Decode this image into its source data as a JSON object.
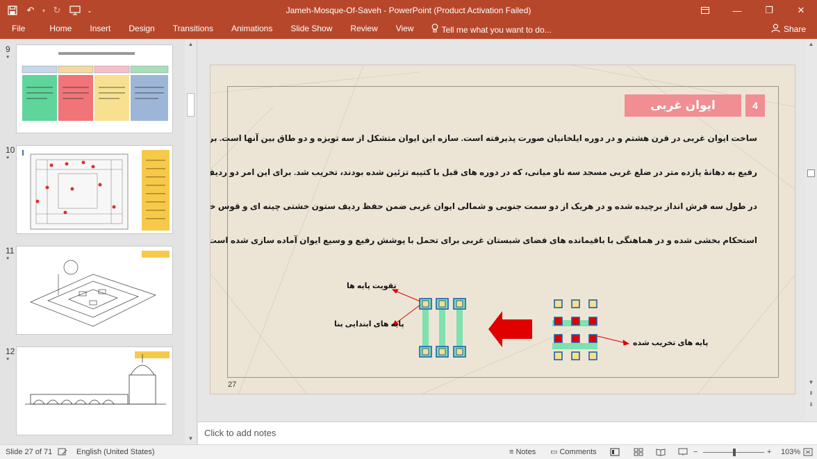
{
  "window": {
    "title": "Jameh-Mosque-Of-Saveh - PowerPoint (Product Activation Failed)",
    "accent": "#b7472a"
  },
  "ribbon": {
    "tabs": [
      "File",
      "Home",
      "Insert",
      "Design",
      "Transitions",
      "Animations",
      "Slide Show",
      "Review",
      "View"
    ],
    "tell_me": "Tell me what you want to do...",
    "share": "Share"
  },
  "thumbnails": [
    {
      "number": "9",
      "star": "*"
    },
    {
      "number": "10",
      "star": "*"
    },
    {
      "number": "11",
      "star": "*"
    },
    {
      "number": "12",
      "star": "*"
    }
  ],
  "slide": {
    "heading": "ایوان غربی",
    "section_number": "4",
    "page_number": "27",
    "body_lines": [
      "ساخت ایوان غربی  در قرن هشتم و در دوره ایلخانیان صورت پذیرفته است. سازه این ایوان متشکل از سه تویزه و دو طاق بین آنها است. برای ساخت این ایوان",
      "رفیع به دهانهٔ یازده متر در ضلع غربی مسجد سه ناو میانی، که در دوره های قبل با کتیبه تزئین شده بودند، تخریب شد. برای این امر دو ردیف از پایه های خشتی",
      "در طول سه فرش انداز برچیده شده و در هریک از دو سمت جنوبی و شمالی ایوان غربی ضمن حفظ ردیف ستون خشتی چینه ای و قوس خشتی میان پایه ها",
      "استحکام بخشی شده و در هماهنگی با باقیمانده های فضای شبستان غربی برای تحمل با پوشش رفیع و وسیع ایوان آماده سازی شده است."
    ],
    "labels": {
      "reinforce": "تقویت پایه ها",
      "original": "پایه های ابتدایی بنا",
      "destroyed": "پایه های تخریب شده"
    },
    "colors": {
      "title_box": "#f08e93",
      "pier_fill": "#f7e08a",
      "pier_border": "#1f5fa8",
      "green": "#7fe0b0",
      "red": "#e00000"
    }
  },
  "notes": {
    "placeholder": "Click to add notes"
  },
  "status": {
    "slide_info": "Slide 27 of 71",
    "language": "English (United States)",
    "notes": "Notes",
    "comments": "Comments",
    "zoom": "103%"
  }
}
